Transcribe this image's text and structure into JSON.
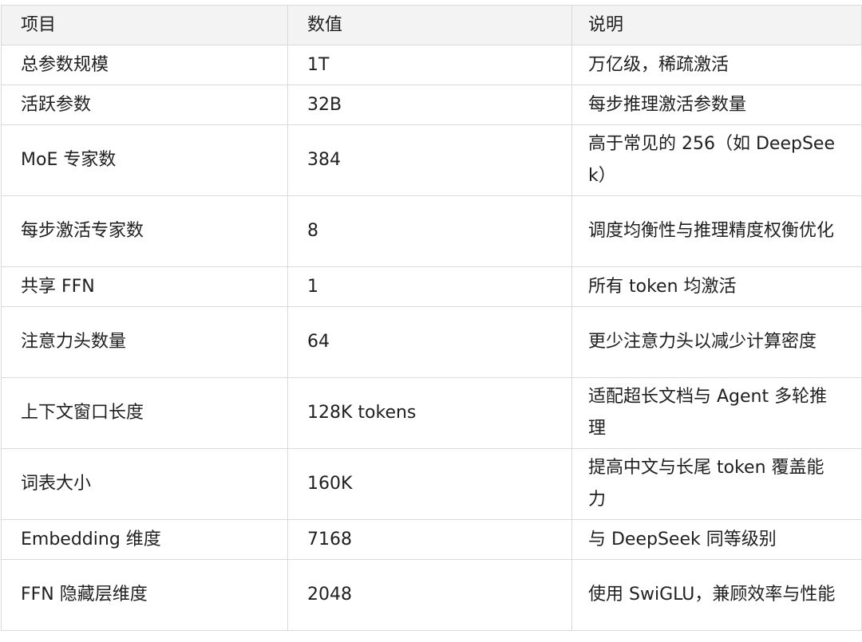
{
  "table": {
    "headers": [
      "项目",
      "数值",
      "说明"
    ],
    "rows": [
      {
        "item": "总参数规模",
        "value": "1T",
        "desc": "万亿级，稀疏激活"
      },
      {
        "item": "活跃参数",
        "value": "32B",
        "desc": "每步推理激活参数量"
      },
      {
        "item": "MoE 专家数",
        "value": "384",
        "desc": "高于常见的 256（如 DeepSeek）"
      },
      {
        "item": "每步激活专家数",
        "value": "8",
        "desc": "调度均衡性与推理精度权衡优化"
      },
      {
        "item": "共享 FFN",
        "value": "1",
        "desc": "所有 token 均激活"
      },
      {
        "item": "注意力头数量",
        "value": "64",
        "desc": "更少注意力头以减少计算密度"
      },
      {
        "item": "上下文窗口长度",
        "value": "128K tokens",
        "desc": "适配超长文档与 Agent 多轮推理"
      },
      {
        "item": "词表大小",
        "value": "160K",
        "desc": "提高中文与长尾 token 覆盖能力"
      },
      {
        "item": "Embedding 维度",
        "value": "7168",
        "desc": "与 DeepSeek 同等级别"
      },
      {
        "item": "FFN 隐藏层维度",
        "value": "2048",
        "desc": "使用 SwiGLU，兼顾效率与性能"
      }
    ]
  }
}
